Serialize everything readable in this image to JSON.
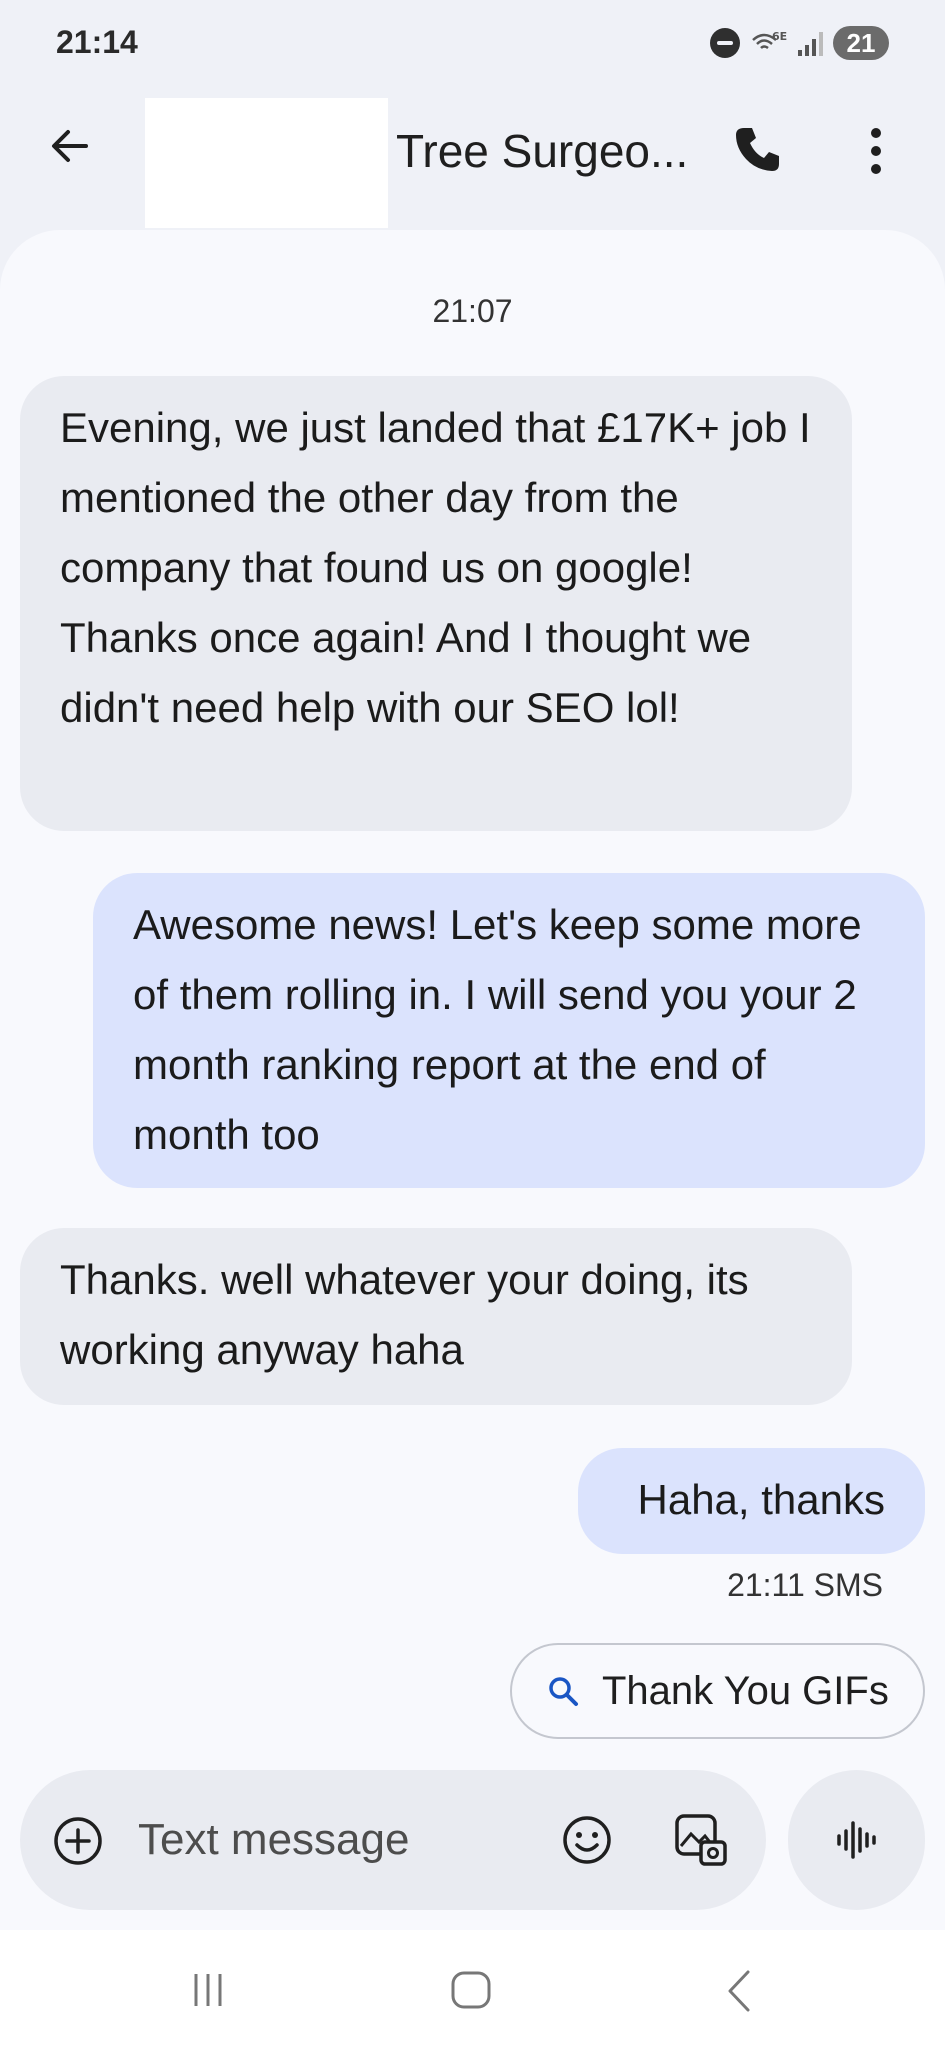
{
  "status_bar": {
    "time": "21:14",
    "battery": "21",
    "network": "6E"
  },
  "header": {
    "contact_name": "Tree Surgeo..."
  },
  "conversation": {
    "day_timestamp": "21:07",
    "messages": [
      {
        "direction": "incoming",
        "text": "Evening, we just landed that £17K+ job I mentioned the other day from the company that found us on google! Thanks once again! And I thought we didn't need help with our SEO lol!"
      },
      {
        "direction": "outgoing",
        "text": "Awesome news! Let's keep some more of them rolling in. I will send you your 2 month ranking report at the end of month too"
      },
      {
        "direction": "incoming",
        "text": "Thanks. well whatever your doing, its working anyway haha"
      },
      {
        "direction": "outgoing",
        "text": "Haha, thanks"
      }
    ],
    "last_meta": "21:11 SMS"
  },
  "suggestion": {
    "label": "Thank You GIFs"
  },
  "composer": {
    "placeholder": "Text message"
  },
  "colors": {
    "incoming_bubble": "#e9ebf1",
    "outgoing_bubble": "#dbe3fd",
    "accent": "#1a56c4"
  },
  "icons": [
    "back-arrow-icon",
    "phone-icon",
    "more-vert-icon",
    "search-icon",
    "add-circle-icon",
    "emoji-icon",
    "gallery-icon",
    "voice-waveform-icon",
    "nav-recents-icon",
    "nav-home-icon",
    "nav-back-icon"
  ]
}
